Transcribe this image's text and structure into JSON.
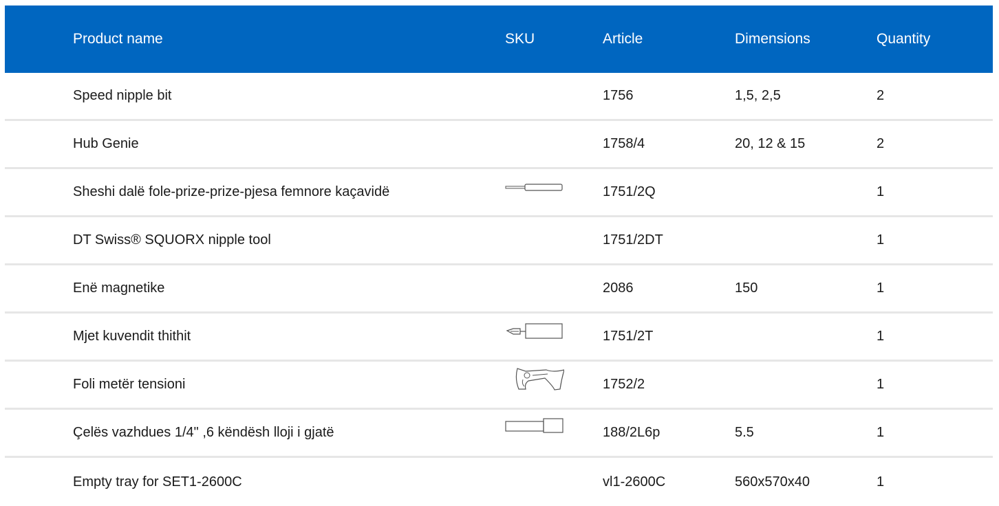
{
  "table": {
    "headers": {
      "product_name": "Product name",
      "sku": "SKU",
      "article": "Article",
      "dimensions": "Dimensions",
      "quantity": "Quantity"
    },
    "rows": [
      {
        "name": "Speed nipple bit",
        "sku_icon": "",
        "article": "1756",
        "dimensions": "1,5, 2,5",
        "quantity": "2"
      },
      {
        "name": "Hub Genie",
        "sku_icon": "",
        "article": "1758/4",
        "dimensions": "20, 12 & 15",
        "quantity": "2"
      },
      {
        "name": "Sheshi dalë fole-prize-prize-pjesa femnore kaçavidë",
        "sku_icon": "screwdriver-icon",
        "article": "1751/2Q",
        "dimensions": "",
        "quantity": "1"
      },
      {
        "name": "DT Swiss® SQUORX nipple tool",
        "sku_icon": "",
        "article": "1751/2DT",
        "dimensions": "",
        "quantity": "1"
      },
      {
        "name": "Enë magnetike",
        "sku_icon": "",
        "article": "2086",
        "dimensions": "150",
        "quantity": "1"
      },
      {
        "name": "Mjet kuvendit thithit",
        "sku_icon": "nipple-driver-icon",
        "article": "1751/2T",
        "dimensions": "",
        "quantity": "1"
      },
      {
        "name": "Foli metër tensioni",
        "sku_icon": "tension-meter-icon",
        "article": "1752/2",
        "dimensions": "",
        "quantity": "1"
      },
      {
        "name": "Çelës vazhdues 1/4\" ,6 këndësh lloji i gjatë",
        "sku_icon": "socket-icon",
        "article": "188/2L6p",
        "dimensions": "5.5",
        "quantity": "1"
      },
      {
        "name": "Empty tray for SET1-2600C",
        "sku_icon": "",
        "article": "vl1-2600C",
        "dimensions": "560x570x40",
        "quantity": "1"
      }
    ]
  }
}
